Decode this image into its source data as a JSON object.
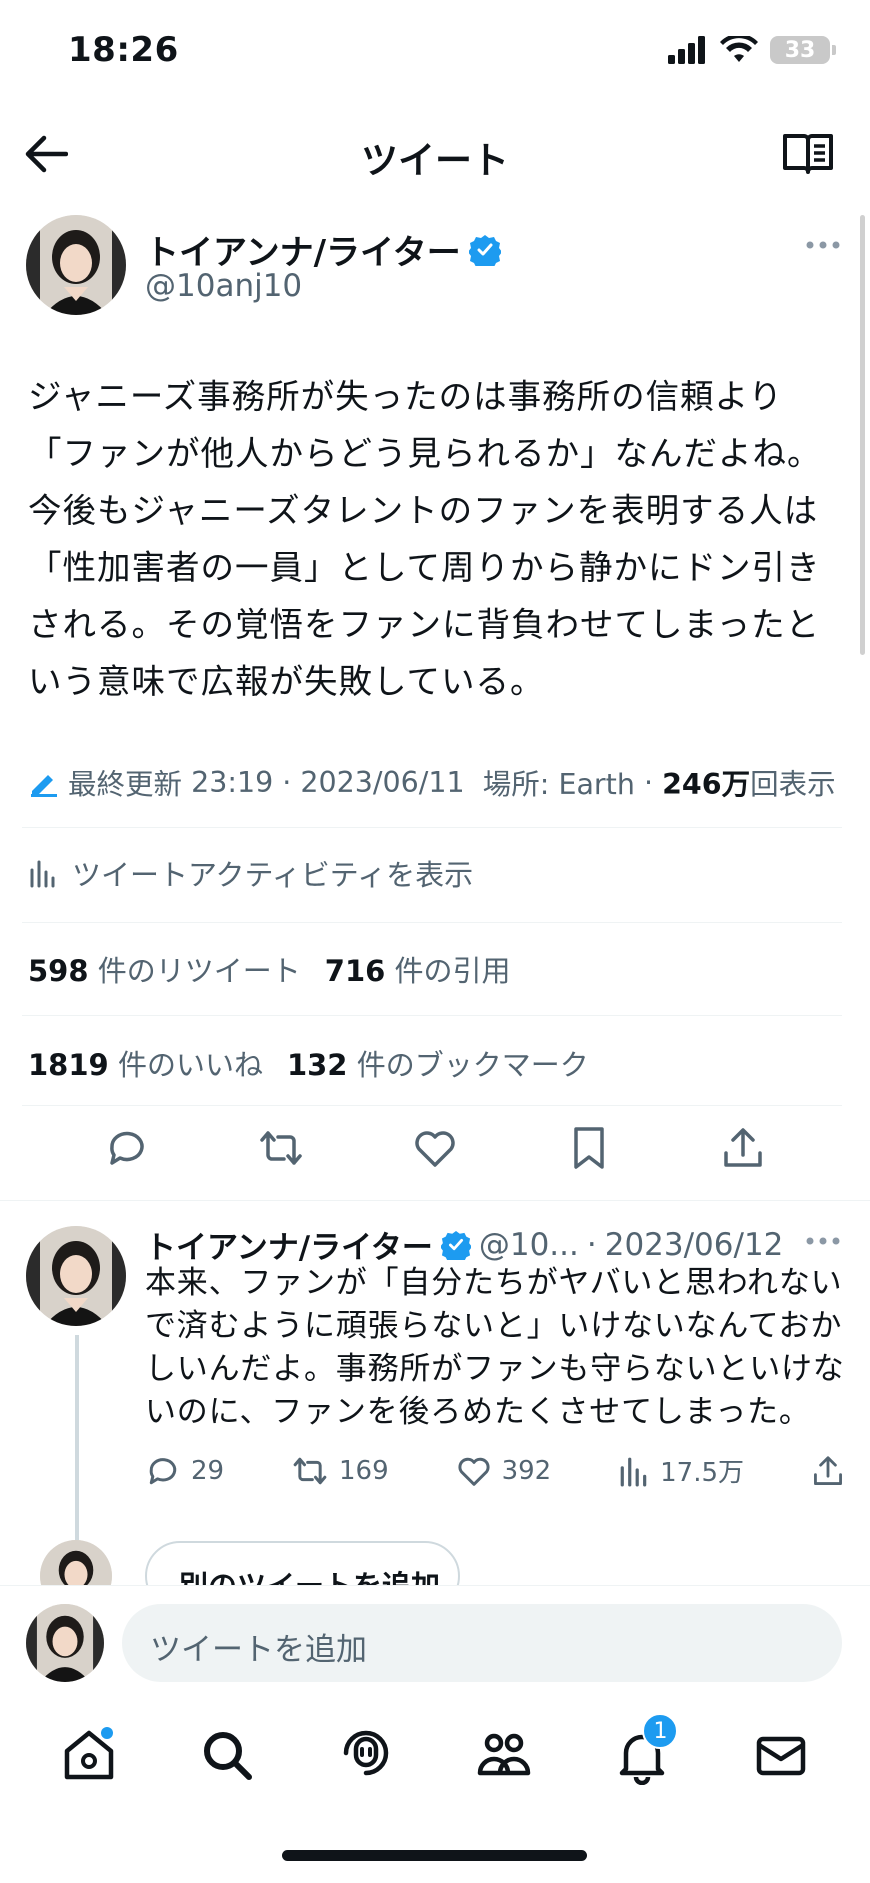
{
  "status_bar": {
    "time": "18:26",
    "battery": "33"
  },
  "header": {
    "title": "ツイート"
  },
  "tweet": {
    "author_name": "トイアンナ/ライター",
    "handle": "@10anj10",
    "text": "ジャニーズ事務所が失ったのは事務所の信頼より「ファンが他人からどう見られるか」なんだよね。今後もジャニーズタレントのファンを表明する人は「性加害者の一員」として周りから静かにドン引きされる。その覚悟をファンに背負わせてしまったという意味で広報が失敗している。",
    "meta": {
      "edited_label": "最終更新",
      "time": "23:19",
      "date": "2023/06/11",
      "location": "場所: Earth",
      "views_count": "246万",
      "views_label": "回表示"
    },
    "activity_link": "ツイートアクティビティを表示",
    "stats": {
      "retweets": "598",
      "retweets_label": "件のリツイート",
      "quotes": "716",
      "quotes_label": "件の引用",
      "likes": "1819",
      "likes_label": "件のいいね",
      "bookmarks": "132",
      "bookmarks_label": "件のブックマーク"
    }
  },
  "reply": {
    "author_name": "トイアンナ/ライター",
    "handle": "@10...",
    "date": "2023/06/12",
    "text": "本来、ファンが「自分たちがヤバいと思われないで済むように頑張らないと」いけないなんておかしいんだよ。事務所がファンも守らないといけないのに、ファンを後ろめたくさせてしまった。",
    "replies": "29",
    "retweets": "169",
    "likes": "392",
    "views": "17.5万"
  },
  "add_thread_button": "別のツイートを追加",
  "compose": {
    "placeholder": "ツイートを追加"
  },
  "tabbar": {
    "notification_badge": "1",
    "icons": [
      "home-icon",
      "search-icon",
      "spaces-icon",
      "communities-icon",
      "bell-icon",
      "mail-icon"
    ]
  },
  "colors": {
    "accent": "#1d9bf0",
    "muted": "#536471",
    "text": "#0f1419"
  }
}
